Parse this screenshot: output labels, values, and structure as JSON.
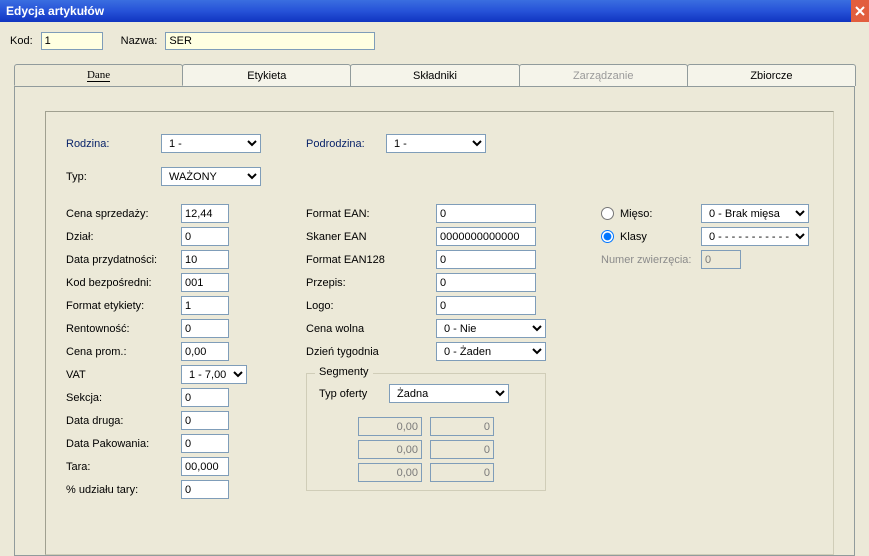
{
  "titlebar": {
    "title": "Edycja artykułów"
  },
  "top": {
    "kod_label": "Kod:",
    "kod_value": "1",
    "nazwa_label": "Nazwa:",
    "nazwa_value": "SER"
  },
  "tabs": {
    "t0": "Dane",
    "t1": "Etykieta",
    "t2": "Składniki",
    "t3": "Zarządzanie",
    "t4": "Zbiorcze"
  },
  "main": {
    "rodzina_label": "Rodzina:",
    "rodzina_value": "1 -",
    "podrodzina_label": "Podrodzina:",
    "podrodzina_value": "1 -",
    "typ_label": "Typ:",
    "typ_value": "WAŻONY"
  },
  "left": {
    "cena_sprz_label": "Cena sprzedaży:",
    "cena_sprz_value": "12,44",
    "dzial_label": "Dział:",
    "dzial_value": "0",
    "data_przyd_label": "Data przydatności:",
    "data_przyd_value": "10",
    "kod_bezp_label": "Kod bezpośredni:",
    "kod_bezp_value": "001",
    "format_etyk_label": "Format etykiety:",
    "format_etyk_value": "1",
    "rentownosc_label": "Rentowność:",
    "rentownosc_value": "0",
    "cena_prom_label": "Cena prom.:",
    "cena_prom_value": "0,00",
    "vat_label": "VAT",
    "vat_value": "1 - 7,00",
    "sekcja_label": "Sekcja:",
    "sekcja_value": "0",
    "data_druga_label": "Data druga:",
    "data_druga_value": "0",
    "data_pak_label": "Data Pakowania:",
    "data_pak_value": "0",
    "tara_label": "Tara:",
    "tara_value": "00,000",
    "udzial_tary_label": "% udziału tary:",
    "udzial_tary_value": "0"
  },
  "mid": {
    "format_ean_label": "Format EAN:",
    "format_ean_value": "0",
    "skaner_ean_label": "Skaner EAN",
    "skaner_ean_value": "0000000000000",
    "format_ean128_label": "Format EAN128",
    "format_ean128_value": "0",
    "przepis_label": "Przepis:",
    "przepis_value": "0",
    "logo_label": "Logo:",
    "logo_value": "0",
    "cena_wolna_label": "Cena wolna",
    "cena_wolna_value": "0 - Nie",
    "dzien_tyg_label": "Dzień tygodnia",
    "dzien_tyg_value": "0 - Żaden",
    "seg_legend": "Segmenty",
    "typ_oferty_label": "Typ oferty",
    "typ_oferty_value": "Żadna",
    "seg_a1": "0,00",
    "seg_a2": "0",
    "seg_b1": "0,00",
    "seg_b2": "0",
    "seg_c1": "0,00",
    "seg_c2": "0"
  },
  "right": {
    "mieso_label": "Mięso:",
    "mieso_value": "0 - Brak mięsa",
    "klasy_label": "Klasy",
    "klasy_value": "0 - - - - - - - - - - -",
    "numer_zw_label": "Numer zwierzęcia:",
    "numer_zw_value": "0"
  }
}
